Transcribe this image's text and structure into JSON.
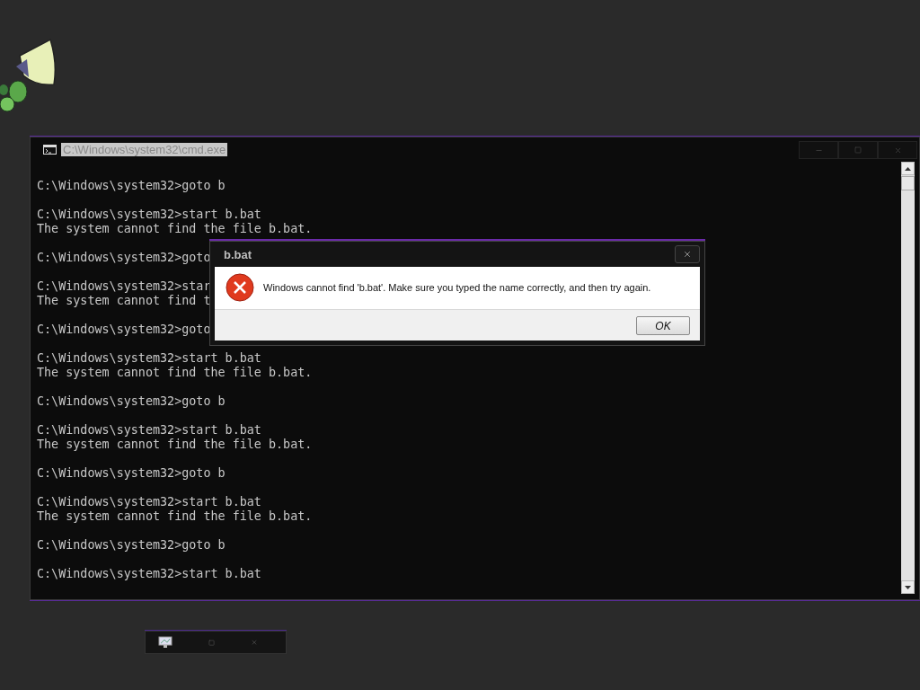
{
  "console_window": {
    "title": "C:\\Windows\\system32\\cmd.exe",
    "blocks": [
      [
        "C:\\Windows\\system32>goto b"
      ],
      [
        "C:\\Windows\\system32>start b.bat",
        "The system cannot find the file b.bat."
      ],
      [
        "C:\\Windows\\system32>goto"
      ],
      [
        "C:\\Windows\\system32>star",
        "The system cannot find t"
      ],
      [
        "C:\\Windows\\system32>goto"
      ],
      [
        "C:\\Windows\\system32>start b.bat",
        "The system cannot find the file b.bat."
      ],
      [
        "C:\\Windows\\system32>goto b"
      ],
      [
        "C:\\Windows\\system32>start b.bat",
        "The system cannot find the file b.bat."
      ],
      [
        "C:\\Windows\\system32>goto b"
      ],
      [
        "C:\\Windows\\system32>start b.bat",
        "The system cannot find the file b.bat."
      ],
      [
        "C:\\Windows\\system32>goto b"
      ],
      [
        "C:\\Windows\\system32>start b.bat"
      ]
    ]
  },
  "dialog": {
    "title": "b.bat",
    "message": "Windows cannot find 'b.bat'. Make sure you typed the name correctly, and then try again.",
    "buttons": [
      "OK"
    ]
  }
}
